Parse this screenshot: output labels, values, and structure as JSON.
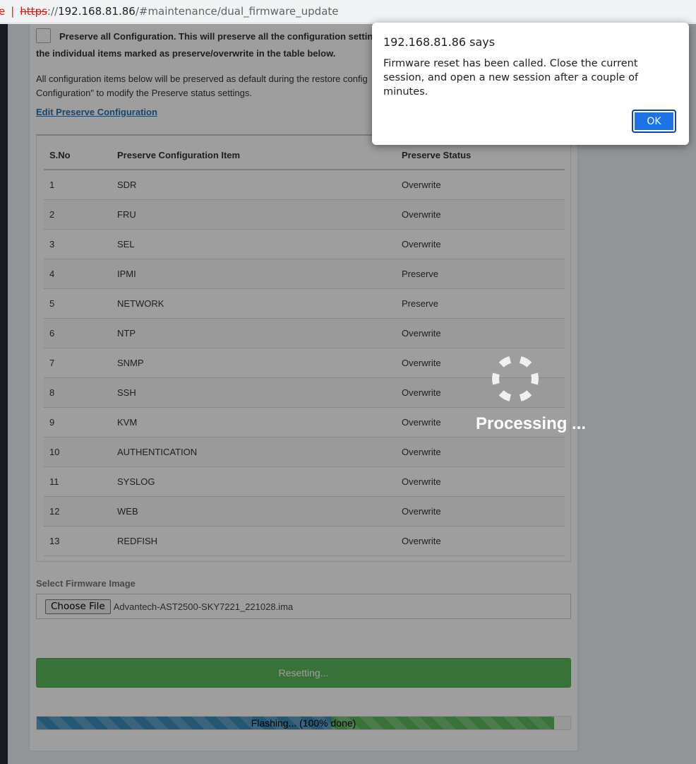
{
  "browser": {
    "not_secure_fragment": "e",
    "url_scheme": "https",
    "url_sep": "://",
    "url_host": "192.168.81.86",
    "url_path": "/#maintenance/dual_firmware_update"
  },
  "preserve_all": {
    "line1": "Preserve all Configuration. This will preserve all the configuration settings",
    "line2": "the individual items marked as preserve/overwrite in the table below.",
    "checked": false
  },
  "info": {
    "line1": "All configuration items below will be preserved as default during the restore config",
    "line2": "Configuration\" to modify the Preserve status settings."
  },
  "edit_link": "Edit Preserve Configuration",
  "table": {
    "headers": [
      "S.No",
      "Preserve Configuration Item",
      "Preserve Status"
    ],
    "rows": [
      [
        "1",
        "SDR",
        "Overwrite"
      ],
      [
        "2",
        "FRU",
        "Overwrite"
      ],
      [
        "3",
        "SEL",
        "Overwrite"
      ],
      [
        "4",
        "IPMI",
        "Preserve"
      ],
      [
        "5",
        "NETWORK",
        "Preserve"
      ],
      [
        "6",
        "NTP",
        "Overwrite"
      ],
      [
        "7",
        "SNMP",
        "Overwrite"
      ],
      [
        "8",
        "SSH",
        "Overwrite"
      ],
      [
        "9",
        "KVM",
        "Overwrite"
      ],
      [
        "10",
        "AUTHENTICATION",
        "Overwrite"
      ],
      [
        "11",
        "SYSLOG",
        "Overwrite"
      ],
      [
        "12",
        "WEB",
        "Overwrite"
      ],
      [
        "13",
        "REDFISH",
        "Overwrite"
      ]
    ]
  },
  "firmware": {
    "label": "Select Firmware Image",
    "choose_button": "Choose File",
    "file_name": "Advantech-AST2500-SKY7221_221028.ima"
  },
  "reset_button": "Resetting...",
  "progress": {
    "label": "Flashing... (100% done)",
    "percent": 97
  },
  "processing": {
    "text": "Processing ...",
    "icon": "spinner-icon"
  },
  "dialog": {
    "title": "192.168.81.86 says",
    "message": "Firmware reset has been called. Close the current session, and open a new session after a couple of minutes.",
    "ok_label": "OK"
  },
  "colors": {
    "progress_blue": "#3c8dbc",
    "progress_green": "#5cb85c",
    "ok_button": "#1a73e8",
    "link": "#2a6fa8"
  }
}
